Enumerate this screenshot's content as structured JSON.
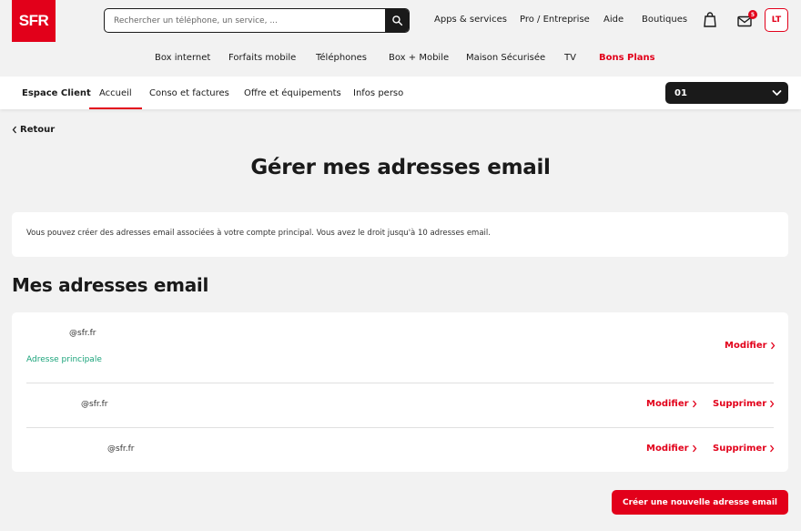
{
  "header": {
    "logo_text": "SFR",
    "search_placeholder": "Rechercher un téléphone, un service, ...",
    "links": [
      "Apps & services",
      "Pro / Entreprise",
      "Aide",
      "Boutiques"
    ],
    "mail_badge": "5",
    "avatar_initials": "LT"
  },
  "main_nav": [
    "Box internet",
    "Forfaits mobile",
    "Téléphones",
    "Box + Mobile",
    "Maison Sécurisée",
    "TV",
    "Bons Plans"
  ],
  "sub_nav": {
    "title": "Espace Client",
    "items": [
      "Accueil",
      "Conso et factures",
      "Offre et équipements",
      "Infos perso"
    ],
    "active": "Accueil",
    "line_selector": "01"
  },
  "back_label": "Retour",
  "page_title": "Gérer mes adresses email",
  "info_text": "Vous pouvez créer des adresses email associées à votre compte principal. Vous avez le droit jusqu'à 10 adresses email.",
  "section_title": "Mes adresses email",
  "emails": [
    {
      "address": "@sfr.fr",
      "tag": "Adresse principale",
      "actions": [
        "Modifier"
      ]
    },
    {
      "address": "@sfr.fr",
      "actions": [
        "Modifier",
        "Supprimer"
      ]
    },
    {
      "address": "@sfr.fr",
      "actions": [
        "Modifier",
        "Supprimer"
      ]
    }
  ],
  "create_button_label": "Créer une nouvelle adresse email",
  "colors": {
    "brand_red": "#e2001a",
    "success_green": "#1aa37a",
    "dark": "#1a1a1a",
    "background": "#f2f2f2"
  }
}
